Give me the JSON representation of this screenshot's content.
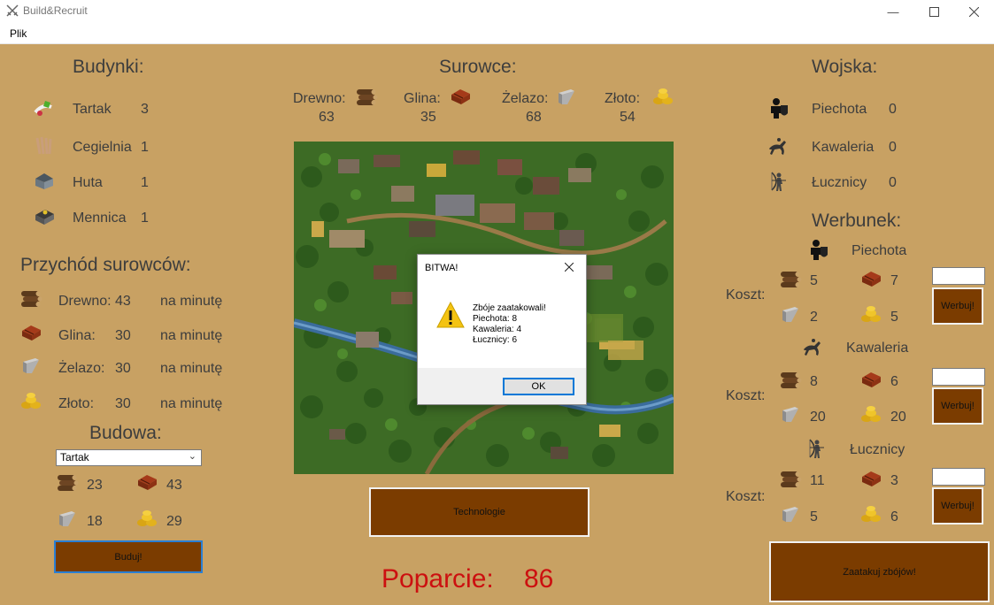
{
  "window": {
    "title": "Build&Recruit"
  },
  "menu": {
    "file": "Plik"
  },
  "buildings": {
    "heading": "Budynki:",
    "items": [
      {
        "name": "Tartak",
        "count": "3",
        "icon": "sawmill-icon"
      },
      {
        "name": "Cegielnia",
        "count": "1",
        "icon": "brickyard-icon"
      },
      {
        "name": "Huta",
        "count": "1",
        "icon": "smelter-icon"
      },
      {
        "name": "Mennica",
        "count": "1",
        "icon": "mint-icon"
      }
    ]
  },
  "income": {
    "heading": "Przychód surowców:",
    "items": [
      {
        "name": "Drewno:",
        "value": "43",
        "unit": "na minutę",
        "icon": "wood-icon"
      },
      {
        "name": "Glina:",
        "value": "30",
        "unit": "na minutę",
        "icon": "clay-icon"
      },
      {
        "name": "Żelazo:",
        "value": "30",
        "unit": "na minutę",
        "icon": "iron-icon"
      },
      {
        "name": "Złoto:",
        "value": "30",
        "unit": "na minutę",
        "icon": "gold-icon"
      }
    ]
  },
  "build": {
    "heading": "Budowa:",
    "selected": "Tartak",
    "cost": {
      "wood": "23",
      "clay": "43",
      "iron": "18",
      "gold": "29"
    },
    "button": "Buduj!"
  },
  "resources": {
    "heading": "Surowce:",
    "items": [
      {
        "name": "Drewno:",
        "value": "63",
        "icon": "wood-icon"
      },
      {
        "name": "Glina:",
        "value": "35",
        "icon": "clay-icon"
      },
      {
        "name": "Żelazo:",
        "value": "68",
        "icon": "iron-icon"
      },
      {
        "name": "Złoto:",
        "value": "54",
        "icon": "gold-icon"
      }
    ]
  },
  "technology_button": "Technologie",
  "support": {
    "label": "Poparcie:",
    "value": "86",
    "color": "#cc1010"
  },
  "army": {
    "heading": "Wojska:",
    "items": [
      {
        "name": "Piechota",
        "count": "0",
        "icon": "infantry-icon"
      },
      {
        "name": "Kawaleria",
        "count": "0",
        "icon": "cavalry-icon"
      },
      {
        "name": "Łucznicy",
        "count": "0",
        "icon": "archer-icon"
      }
    ]
  },
  "recruit": {
    "heading": "Werbunek:",
    "cost_label": "Koszt:",
    "button": "Werbuj!",
    "units": [
      {
        "name": "Piechota",
        "icon": "infantry-icon",
        "wood": "5",
        "clay": "7",
        "iron": "2",
        "gold": "5"
      },
      {
        "name": "Kawaleria",
        "icon": "cavalry-icon",
        "wood": "8",
        "clay": "6",
        "iron": "20",
        "gold": "20"
      },
      {
        "name": "Łucznicy",
        "icon": "archer-icon",
        "wood": "11",
        "clay": "3",
        "iron": "5",
        "gold": "6"
      }
    ]
  },
  "attack_button": "Zaatakuj zbójów!",
  "dialog": {
    "title": "BITWA!",
    "line1": "Zbóje zaatakowali!",
    "line2": "Piechota: 8",
    "line3": "Kawaleria: 4",
    "line4": "Łucznicy: 6",
    "ok": "OK"
  },
  "colors": {
    "background": "#c8a163",
    "button": "#7b3c00",
    "accent": "#0078d7"
  }
}
